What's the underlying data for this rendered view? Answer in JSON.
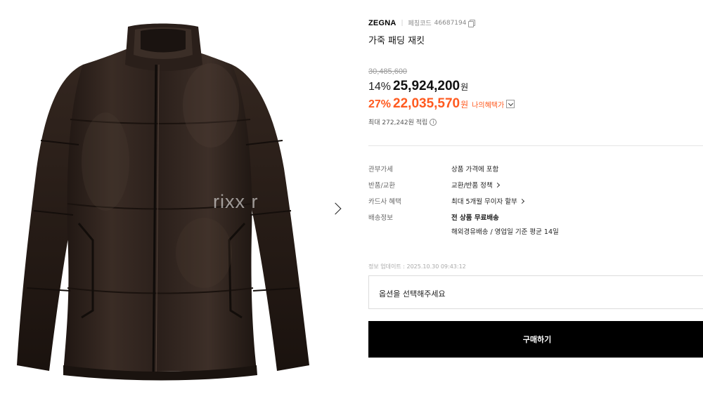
{
  "gallery": {
    "watermark": "rixx   r",
    "next_icon": "chevron-right-icon"
  },
  "product": {
    "brand": "ZEGNA",
    "code_label": "페칭코드",
    "code_value": "46687194",
    "name": "가죽 패딩 재킷"
  },
  "pricing": {
    "original_price": "30,485,600",
    "discount_pct": "14%",
    "sale_price": "25,924,200",
    "currency": "원",
    "best_pct": "27%",
    "best_price": "22,035,570",
    "benefit_label": "나의혜택가",
    "points_text": "최대 272,242원 적립",
    "accent_color": "#ff5a1f"
  },
  "specs": [
    {
      "label": "관부가세",
      "value": "상품 가격에 포함"
    },
    {
      "label": "반품/교환",
      "value": "교환/반품 정책"
    },
    {
      "label": "카드사 혜택",
      "value": "최대 5개월 무이자 할부"
    },
    {
      "label": "배송정보",
      "value": "전 상품 무료배송",
      "value2": "해외경유배송 / 영업일 기준 평균 14일"
    }
  ],
  "updated_text": "정보 업데이트 : 2025.10.30 09:43:12",
  "option_placeholder": "옵션을 선택해주세요",
  "buy_label": "구매하기"
}
